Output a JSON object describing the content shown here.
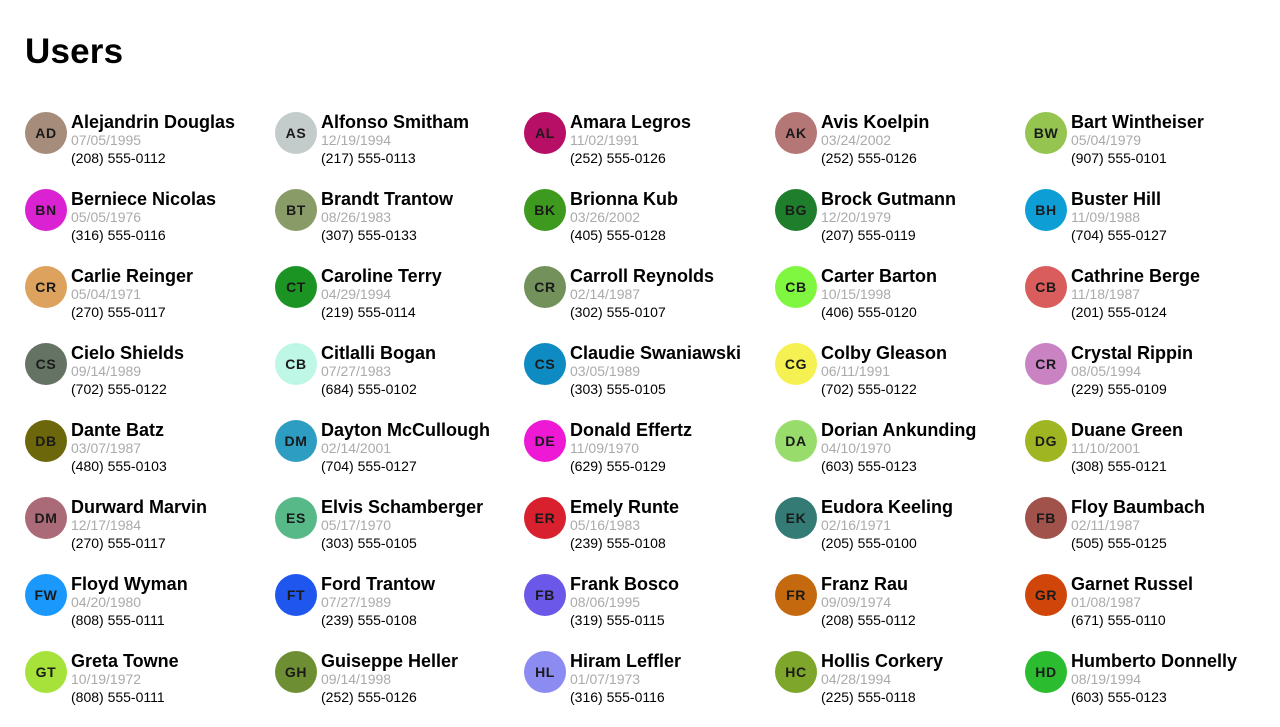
{
  "page": {
    "title": "Users"
  },
  "users": [
    {
      "name": "Alejandrin Douglas",
      "initials": "AD",
      "dob": "07/05/1995",
      "phone": "(208) 555-0112",
      "color": "#A68C7A"
    },
    {
      "name": "Alfonso Smitham",
      "initials": "AS",
      "dob": "12/19/1994",
      "phone": "(217) 555-0113",
      "color": "#C4CBCB"
    },
    {
      "name": "Amara Legros",
      "initials": "AL",
      "dob": "11/02/1991",
      "phone": "(252) 555-0126",
      "color": "#B80F66"
    },
    {
      "name": "Avis Koelpin",
      "initials": "AK",
      "dob": "03/24/2002",
      "phone": "(252) 555-0126",
      "color": "#B57775"
    },
    {
      "name": "Bart Wintheiser",
      "initials": "BW",
      "dob": "05/04/1979",
      "phone": "(907) 555-0101",
      "color": "#95C550"
    },
    {
      "name": "Berniece Nicolas",
      "initials": "BN",
      "dob": "05/05/1976",
      "phone": "(316) 555-0116",
      "color": "#DB22D2"
    },
    {
      "name": "Brandt Trantow",
      "initials": "BT",
      "dob": "08/26/1983",
      "phone": "(307) 555-0133",
      "color": "#899B66"
    },
    {
      "name": "Brionna Kub",
      "initials": "BK",
      "dob": "03/26/2002",
      "phone": "(405) 555-0128",
      "color": "#3E9A1E"
    },
    {
      "name": "Brock Gutmann",
      "initials": "BG",
      "dob": "12/20/1979",
      "phone": "(207) 555-0119",
      "color": "#1F7E2C"
    },
    {
      "name": "Buster Hill",
      "initials": "BH",
      "dob": "11/09/1988",
      "phone": "(704) 555-0127",
      "color": "#0E9ED6"
    },
    {
      "name": "Carlie Reinger",
      "initials": "CR",
      "dob": "05/04/1971",
      "phone": "(270) 555-0117",
      "color": "#DDA35E"
    },
    {
      "name": "Caroline Terry",
      "initials": "CT",
      "dob": "04/29/1994",
      "phone": "(219) 555-0114",
      "color": "#1C9424"
    },
    {
      "name": "Carroll Reynolds",
      "initials": "CR",
      "dob": "02/14/1987",
      "phone": "(302) 555-0107",
      "color": "#72915B"
    },
    {
      "name": "Carter Barton",
      "initials": "CB",
      "dob": "10/15/1998",
      "phone": "(406) 555-0120",
      "color": "#7FF640"
    },
    {
      "name": "Cathrine Berge",
      "initials": "CB",
      "dob": "11/18/1987",
      "phone": "(201) 555-0124",
      "color": "#D85D5C"
    },
    {
      "name": "Cielo Shields",
      "initials": "CS",
      "dob": "09/14/1989",
      "phone": "(702) 555-0122",
      "color": "#657364"
    },
    {
      "name": "Citlalli Bogan",
      "initials": "CB",
      "dob": "07/27/1983",
      "phone": "(684) 555-0102",
      "color": "#BFF7E7"
    },
    {
      "name": "Claudie Swaniawski",
      "initials": "CS",
      "dob": "03/05/1989",
      "phone": "(303) 555-0105",
      "color": "#0E8BC2"
    },
    {
      "name": "Colby Gleason",
      "initials": "CG",
      "dob": "06/11/1991",
      "phone": "(702) 555-0122",
      "color": "#F6F153"
    },
    {
      "name": "Crystal Rippin",
      "initials": "CR",
      "dob": "08/05/1994",
      "phone": "(229) 555-0109",
      "color": "#C983C3"
    },
    {
      "name": "Dante Batz",
      "initials": "DB",
      "dob": "03/07/1987",
      "phone": "(480) 555-0103",
      "color": "#6C670A"
    },
    {
      "name": "Dayton McCullough",
      "initials": "DM",
      "dob": "02/14/2001",
      "phone": "(704) 555-0127",
      "color": "#2E9DC2"
    },
    {
      "name": "Donald Effertz",
      "initials": "DE",
      "dob": "11/09/1970",
      "phone": "(629) 555-0129",
      "color": "#EE19D5"
    },
    {
      "name": "Dorian Ankunding",
      "initials": "DA",
      "dob": "04/10/1970",
      "phone": "(603) 555-0123",
      "color": "#98DC6C"
    },
    {
      "name": "Duane Green",
      "initials": "DG",
      "dob": "11/10/2001",
      "phone": "(308) 555-0121",
      "color": "#A0B522"
    },
    {
      "name": "Durward Marvin",
      "initials": "DM",
      "dob": "12/17/1984",
      "phone": "(270) 555-0117",
      "color": "#AB6A78"
    },
    {
      "name": "Elvis Schamberger",
      "initials": "ES",
      "dob": "05/17/1970",
      "phone": "(303) 555-0105",
      "color": "#57B988"
    },
    {
      "name": "Emely Runte",
      "initials": "ER",
      "dob": "05/16/1983",
      "phone": "(239) 555-0108",
      "color": "#D8202F"
    },
    {
      "name": "Eudora Keeling",
      "initials": "EK",
      "dob": "02/16/1971",
      "phone": "(205) 555-0100",
      "color": "#347B76"
    },
    {
      "name": "Floy Baumbach",
      "initials": "FB",
      "dob": "02/11/1987",
      "phone": "(505) 555-0125",
      "color": "#A1524B"
    },
    {
      "name": "Floyd Wyman",
      "initials": "FW",
      "dob": "04/20/1980",
      "phone": "(808) 555-0111",
      "color": "#1A98FB"
    },
    {
      "name": "Ford Trantow",
      "initials": "FT",
      "dob": "07/27/1989",
      "phone": "(239) 555-0108",
      "color": "#1F57EE"
    },
    {
      "name": "Frank Bosco",
      "initials": "FB",
      "dob": "08/06/1995",
      "phone": "(319) 555-0115",
      "color": "#6B58E8"
    },
    {
      "name": "Franz Rau",
      "initials": "FR",
      "dob": "09/09/1974",
      "phone": "(208) 555-0112",
      "color": "#C5690E"
    },
    {
      "name": "Garnet Russel",
      "initials": "GR",
      "dob": "01/08/1987",
      "phone": "(671) 555-0110",
      "color": "#D0460A"
    },
    {
      "name": "Greta Towne",
      "initials": "GT",
      "dob": "10/19/1972",
      "phone": "(808) 555-0111",
      "color": "#A6E23A"
    },
    {
      "name": "Guiseppe Heller",
      "initials": "GH",
      "dob": "09/14/1998",
      "phone": "(252) 555-0126",
      "color": "#6E8E34"
    },
    {
      "name": "Hiram Leffler",
      "initials": "HL",
      "dob": "01/07/1973",
      "phone": "(316) 555-0116",
      "color": "#8B8BF2"
    },
    {
      "name": "Hollis Corkery",
      "initials": "HC",
      "dob": "04/28/1994",
      "phone": "(225) 555-0118",
      "color": "#7DA62A"
    },
    {
      "name": "Humberto Donnelly",
      "initials": "HD",
      "dob": "08/19/1994",
      "phone": "(603) 555-0123",
      "color": "#2BBD2F"
    }
  ]
}
